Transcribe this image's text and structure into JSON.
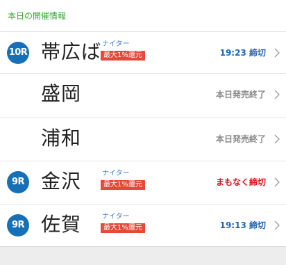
{
  "header": {
    "title": "本日の開催情報"
  },
  "races": [
    {
      "race_number": "10R",
      "venue": "帯広ば",
      "night_label": "ナイター",
      "cashback": "最大1%還元",
      "status": "19:23 締切",
      "status_type": "time"
    },
    {
      "race_number": "",
      "venue": "盛岡",
      "night_label": "",
      "cashback": "",
      "status": "本日発売終了",
      "status_type": "ended"
    },
    {
      "race_number": "",
      "venue": "浦和",
      "night_label": "",
      "cashback": "",
      "status": "本日発売終了",
      "status_type": "ended"
    },
    {
      "race_number": "9R",
      "venue": "金沢",
      "night_label": "ナイター",
      "cashback": "最大1%還元",
      "status": "まもなく締切",
      "status_type": "soon"
    },
    {
      "race_number": "9R",
      "venue": "佐賀",
      "night_label": "ナイター",
      "cashback": "最大1%還元",
      "status": "19:13 締切",
      "status_type": "time"
    }
  ],
  "icons": {
    "chevron": "chevron-right-icon"
  },
  "colors": {
    "header_text": "#3aa536",
    "race_badge": "#1670b8",
    "night_label": "#3a7dc8",
    "cashback_badge": "#e34a37",
    "status_time": "#1f66b4",
    "status_ended": "#8a8a8a",
    "status_soon": "#e1141b"
  }
}
